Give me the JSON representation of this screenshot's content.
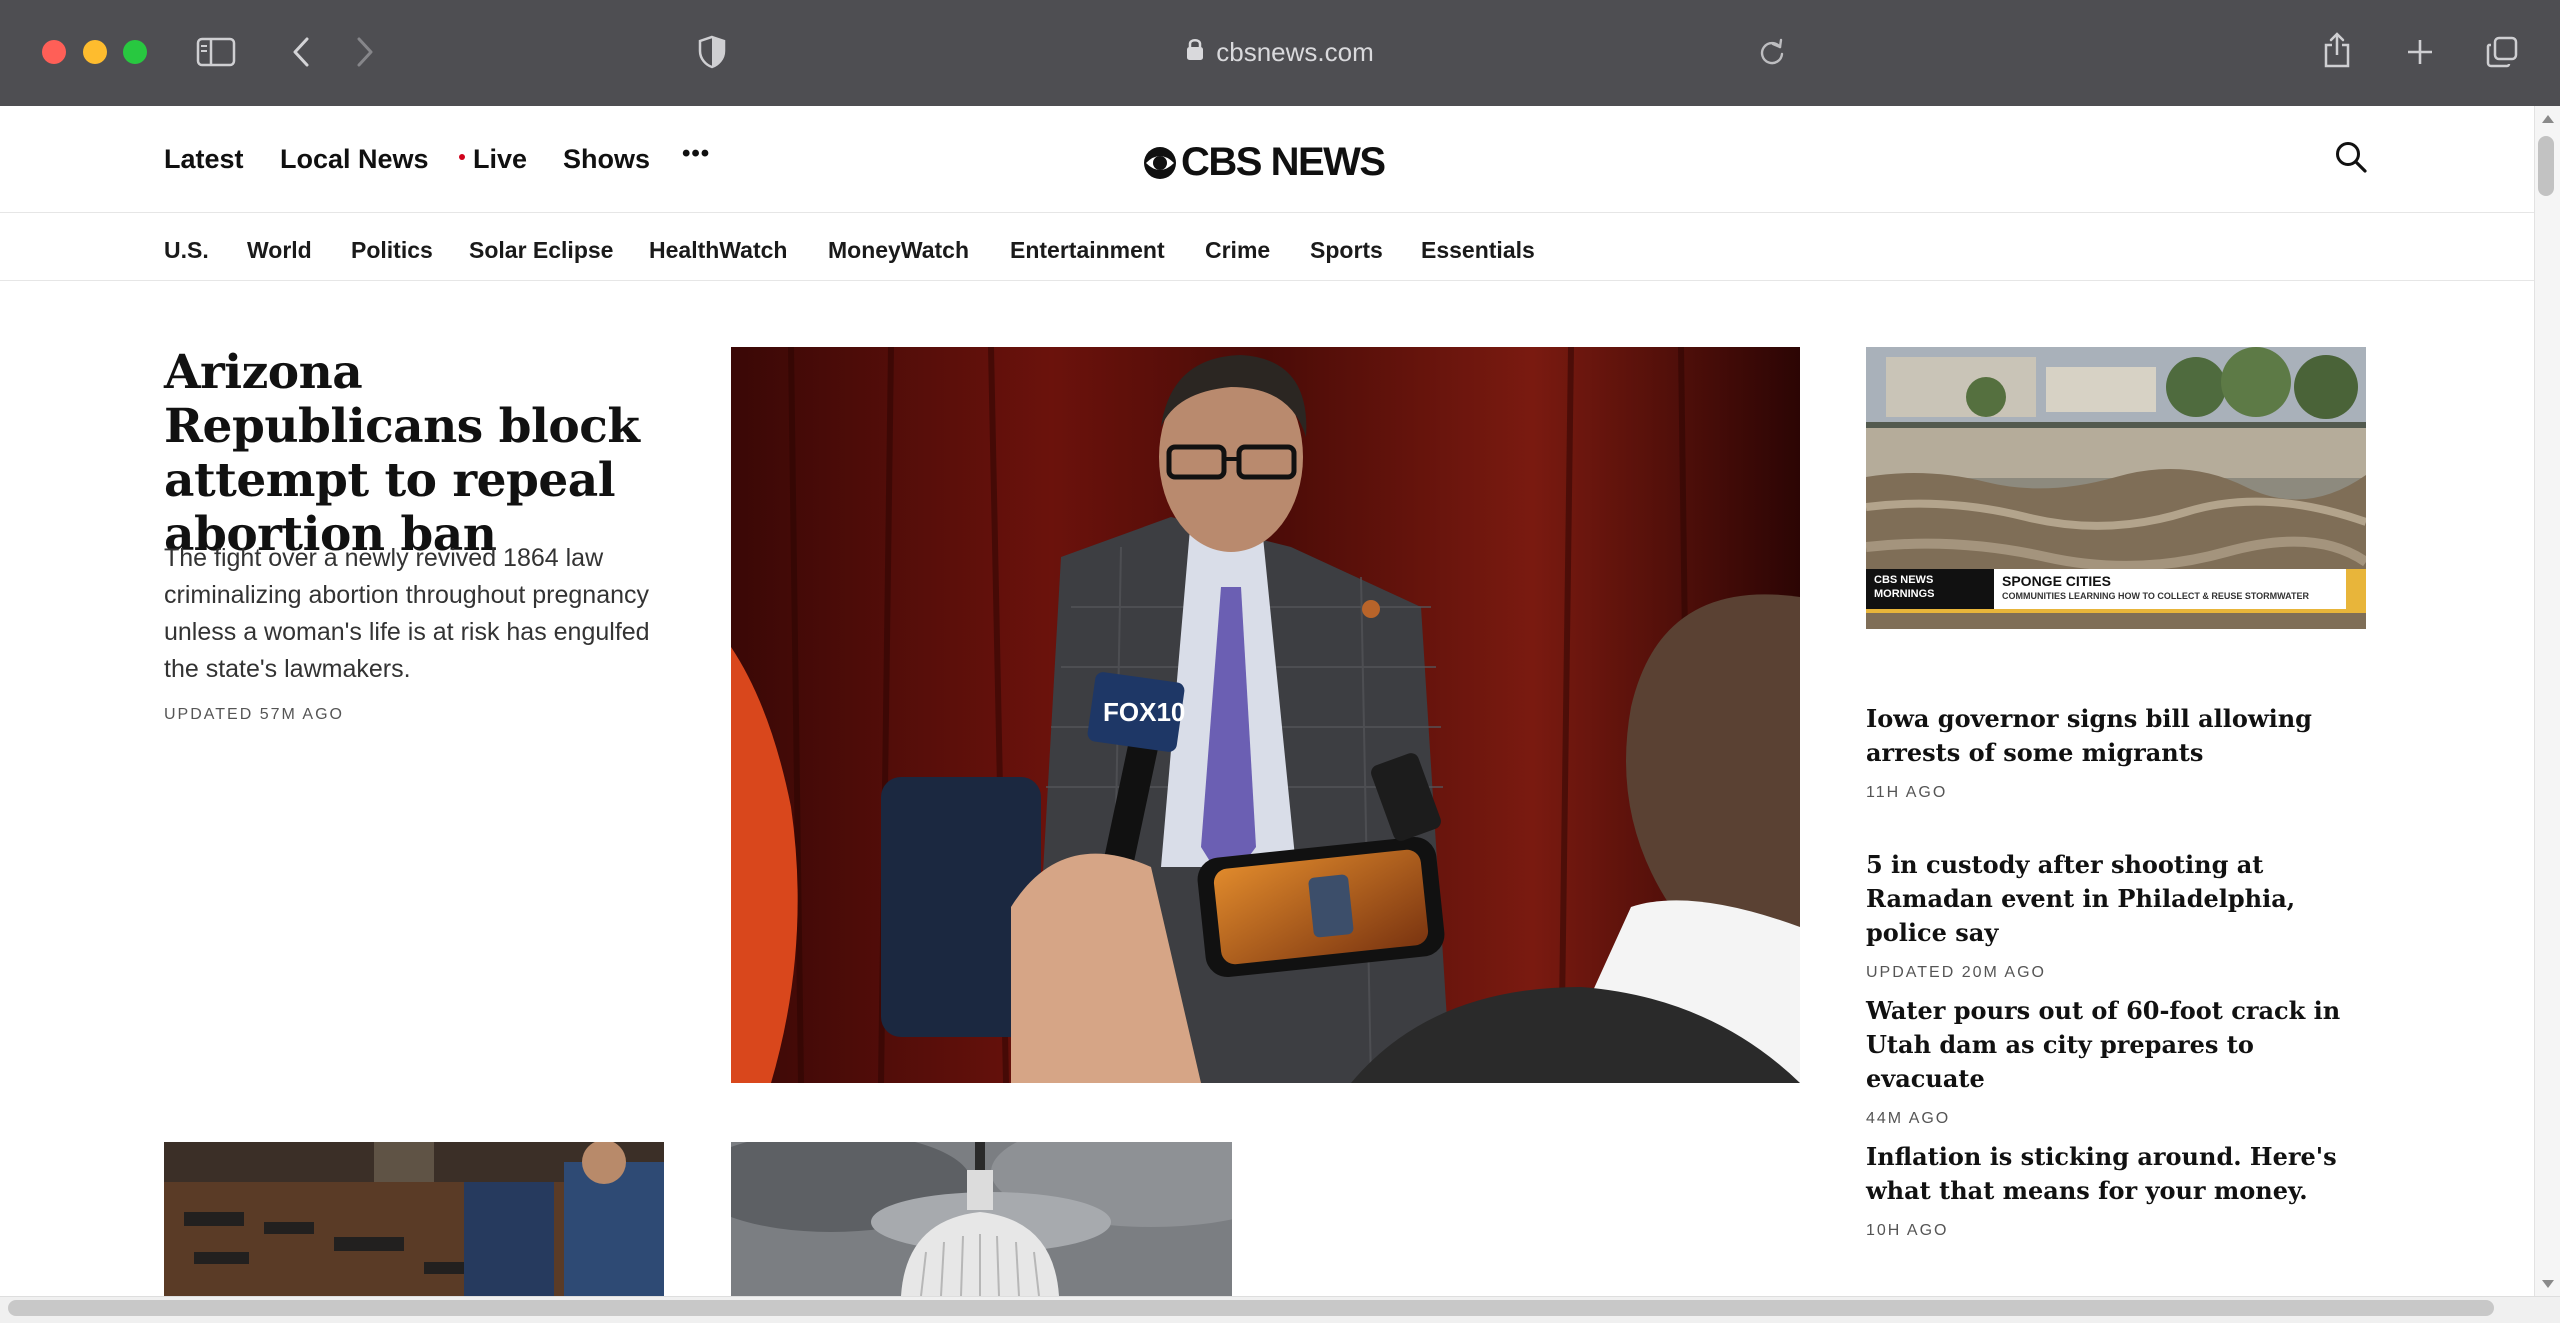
{
  "browser": {
    "url": "cbsnews.com",
    "icons": {
      "sidebar": "sidebar-icon",
      "back": "chevron-left-icon",
      "forward": "chevron-right-icon",
      "privacy": "shield-icon",
      "lock": "lock-icon",
      "reload": "reload-icon",
      "share": "share-icon",
      "new_tab": "plus-icon",
      "tabs": "tabs-overview-icon"
    }
  },
  "site": {
    "logo_text": "CBS NEWS",
    "top_nav": {
      "latest": "Latest",
      "local_news": "Local News",
      "live": "Live",
      "shows": "Shows",
      "more": "•••"
    },
    "sub_nav": [
      "U.S.",
      "World",
      "Politics",
      "Solar Eclipse",
      "HealthWatch",
      "MoneyWatch",
      "Entertainment",
      "Crime",
      "Sports",
      "Essentials"
    ],
    "accent_color": "#d0021b"
  },
  "lead": {
    "title": "Arizona Republicans block attempt to repeal abortion ban",
    "dek": "The fight over a newly revived 1864 law criminalizing abortion throughout pregnancy unless a woman's life is at risk has engulfed the state's lawmakers.",
    "timestamp": "UPDATED 57M AGO",
    "image": {
      "mic_logo": "FOX10"
    }
  },
  "video_thumb": {
    "brand": "CBS NEWS MORNINGS",
    "title": "SPONGE CITIES",
    "subtitle": "COMMUNITIES LEARNING HOW TO COLLECT & REUSE STORMWATER"
  },
  "side_stories": [
    {
      "title": "Iowa governor signs bill allowing arrests of some migrants",
      "timestamp": "11H AGO"
    },
    {
      "title": "5 in custody after shooting at Ramadan event in Philadelphia, police say",
      "timestamp": "UPDATED 20M AGO"
    },
    {
      "title": "Water pours out of 60-foot crack in Utah dam as city prepares to evacuate",
      "timestamp": "44M AGO"
    },
    {
      "title": "Inflation is sticking around. Here's what that means for your money.",
      "timestamp": "10H AGO"
    }
  ]
}
